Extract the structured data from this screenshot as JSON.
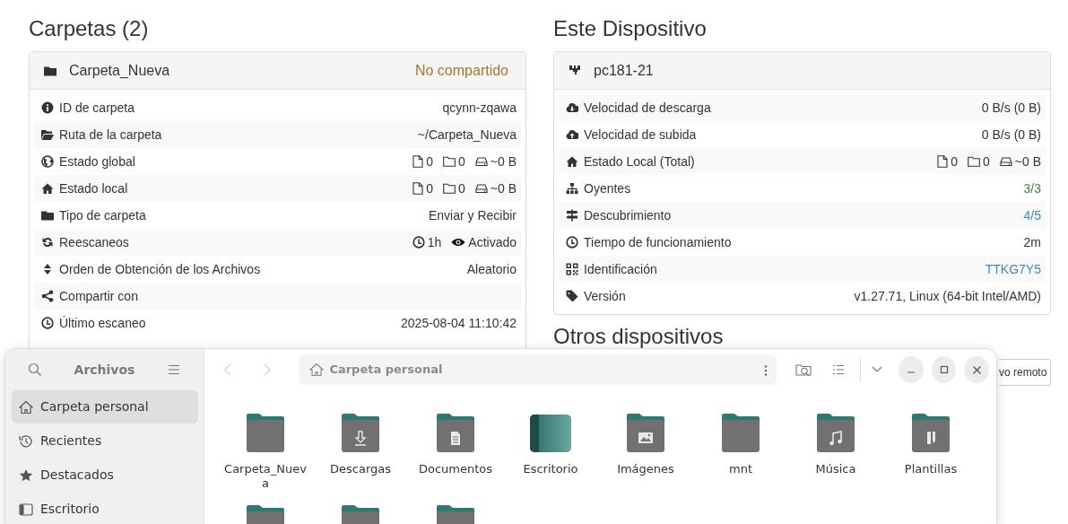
{
  "folders_section": {
    "heading": "Carpetas (2)",
    "folder": {
      "name": "Carpeta_Nueva",
      "share": {
        "label": "No compartido",
        "color": "#a0782e"
      },
      "rows": [
        {
          "kind": "text",
          "label": "ID de carpeta",
          "value": "qcynn-zqawa"
        },
        {
          "kind": "text",
          "label": "Ruta de la carpeta",
          "value": "~/Carpeta_Nueva"
        },
        {
          "kind": "stats",
          "label": "Estado global",
          "files": "0",
          "dirs": "0",
          "size": "~0 B"
        },
        {
          "kind": "stats",
          "label": "Estado local",
          "files": "0",
          "dirs": "0",
          "size": "~0 B"
        },
        {
          "kind": "text",
          "label": "Tipo de carpeta",
          "value": "Enviar y Recibir"
        },
        {
          "kind": "rescan",
          "label": "Reescaneos",
          "interval": "1h",
          "watcher": "Activado"
        },
        {
          "kind": "text",
          "label": "Orden de Obtención de los Archivos",
          "value": "Aleatorio"
        },
        {
          "kind": "text",
          "label": "Compartir con"
        },
        {
          "kind": "text",
          "label": "Último escaneo",
          "value": "2025-08-04 11:10:42"
        }
      ]
    }
  },
  "device_section": {
    "heading": "Este Dispositivo",
    "device": {
      "name": "pc181-21",
      "rows": [
        {
          "kind": "text",
          "label": "Velocidad de descarga",
          "value": "0 B/s (0 B)"
        },
        {
          "kind": "text",
          "label": "Velocidad de subida",
          "value": "0 B/s (0 B)"
        },
        {
          "kind": "stats",
          "label": "Estado Local (Total)",
          "files": "0",
          "dirs": "0",
          "size": "~0 B"
        },
        {
          "kind": "text",
          "label": "Oyentes",
          "value": "3/3",
          "color": "#3c8b3c"
        },
        {
          "kind": "text",
          "label": "Descubrimiento",
          "value": "4/5",
          "color": "#3d87c8"
        },
        {
          "kind": "text",
          "label": "Tiempo de funcionamiento",
          "value": "2m"
        },
        {
          "kind": "text",
          "label": "Identificación",
          "value": "TTKG7Y5",
          "color": "#3d87c8"
        },
        {
          "kind": "text",
          "label": "Versión",
          "value": "v1.27.71, Linux (64-bit Intel/AMD)"
        }
      ]
    },
    "other_heading": "Otros dispositivos",
    "add_button": "vo remoto"
  },
  "file_manager": {
    "title": "Archivos",
    "path": "Carpeta personal",
    "back": {
      "disabled": true
    },
    "forward": {
      "disabled": true
    },
    "sidebar": [
      {
        "label": "Carpeta personal",
        "selected": true
      },
      {
        "label": "Recientes",
        "selected": false
      },
      {
        "label": "Destacados",
        "selected": false
      },
      {
        "label": "Escritorio",
        "selected": false
      }
    ],
    "files": [
      {
        "kind": "plain",
        "name": "Carpeta_Nueva"
      },
      {
        "kind": "download",
        "name": "Descargas"
      },
      {
        "kind": "document",
        "name": "Documentos"
      },
      {
        "kind": "desktop",
        "name": "Escritorio"
      },
      {
        "kind": "pictures",
        "name": "Imágenes"
      },
      {
        "kind": "plain",
        "name": "mnt"
      },
      {
        "kind": "music",
        "name": "Música"
      },
      {
        "kind": "templates",
        "name": "Plantillas"
      },
      {
        "kind": "plain"
      },
      {
        "kind": "plain"
      },
      {
        "kind": "plain"
      }
    ]
  }
}
